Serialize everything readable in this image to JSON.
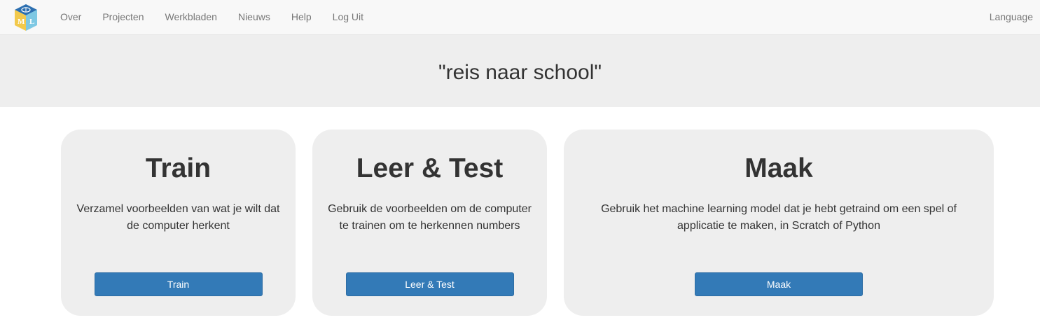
{
  "navbar": {
    "logo_letters": [
      "M",
      "L"
    ],
    "links": [
      {
        "label": "Over"
      },
      {
        "label": "Projecten"
      },
      {
        "label": "Werkbladen"
      },
      {
        "label": "Nieuws"
      },
      {
        "label": "Help"
      },
      {
        "label": "Log Uit"
      }
    ],
    "language_label": "Language"
  },
  "header": {
    "title": "\"reis naar school\""
  },
  "cards": {
    "train": {
      "heading": "Train",
      "text": "Verzamel voorbeelden van wat je wilt dat de computer herkent",
      "button": "Train"
    },
    "learn": {
      "heading": "Leer & Test",
      "text": "Gebruik de voorbeelden om de computer te trainen om te herkennen numbers",
      "button": "Leer & Test"
    },
    "make": {
      "heading": "Maak",
      "text": "Gebruik het machine learning model dat je hebt getraind om een spel of applicatie te maken, in Scratch of Python",
      "button": "Maak"
    }
  },
  "colors": {
    "navbar_bg": "#f8f8f8",
    "jumbotron_bg": "#eeeeee",
    "card_bg": "#eeeeee",
    "button_primary": "#337ab7",
    "nav_text": "#777777",
    "logo_top": "#2c6fb0",
    "logo_left": "#f2c94c",
    "logo_right": "#7ec8e3"
  }
}
